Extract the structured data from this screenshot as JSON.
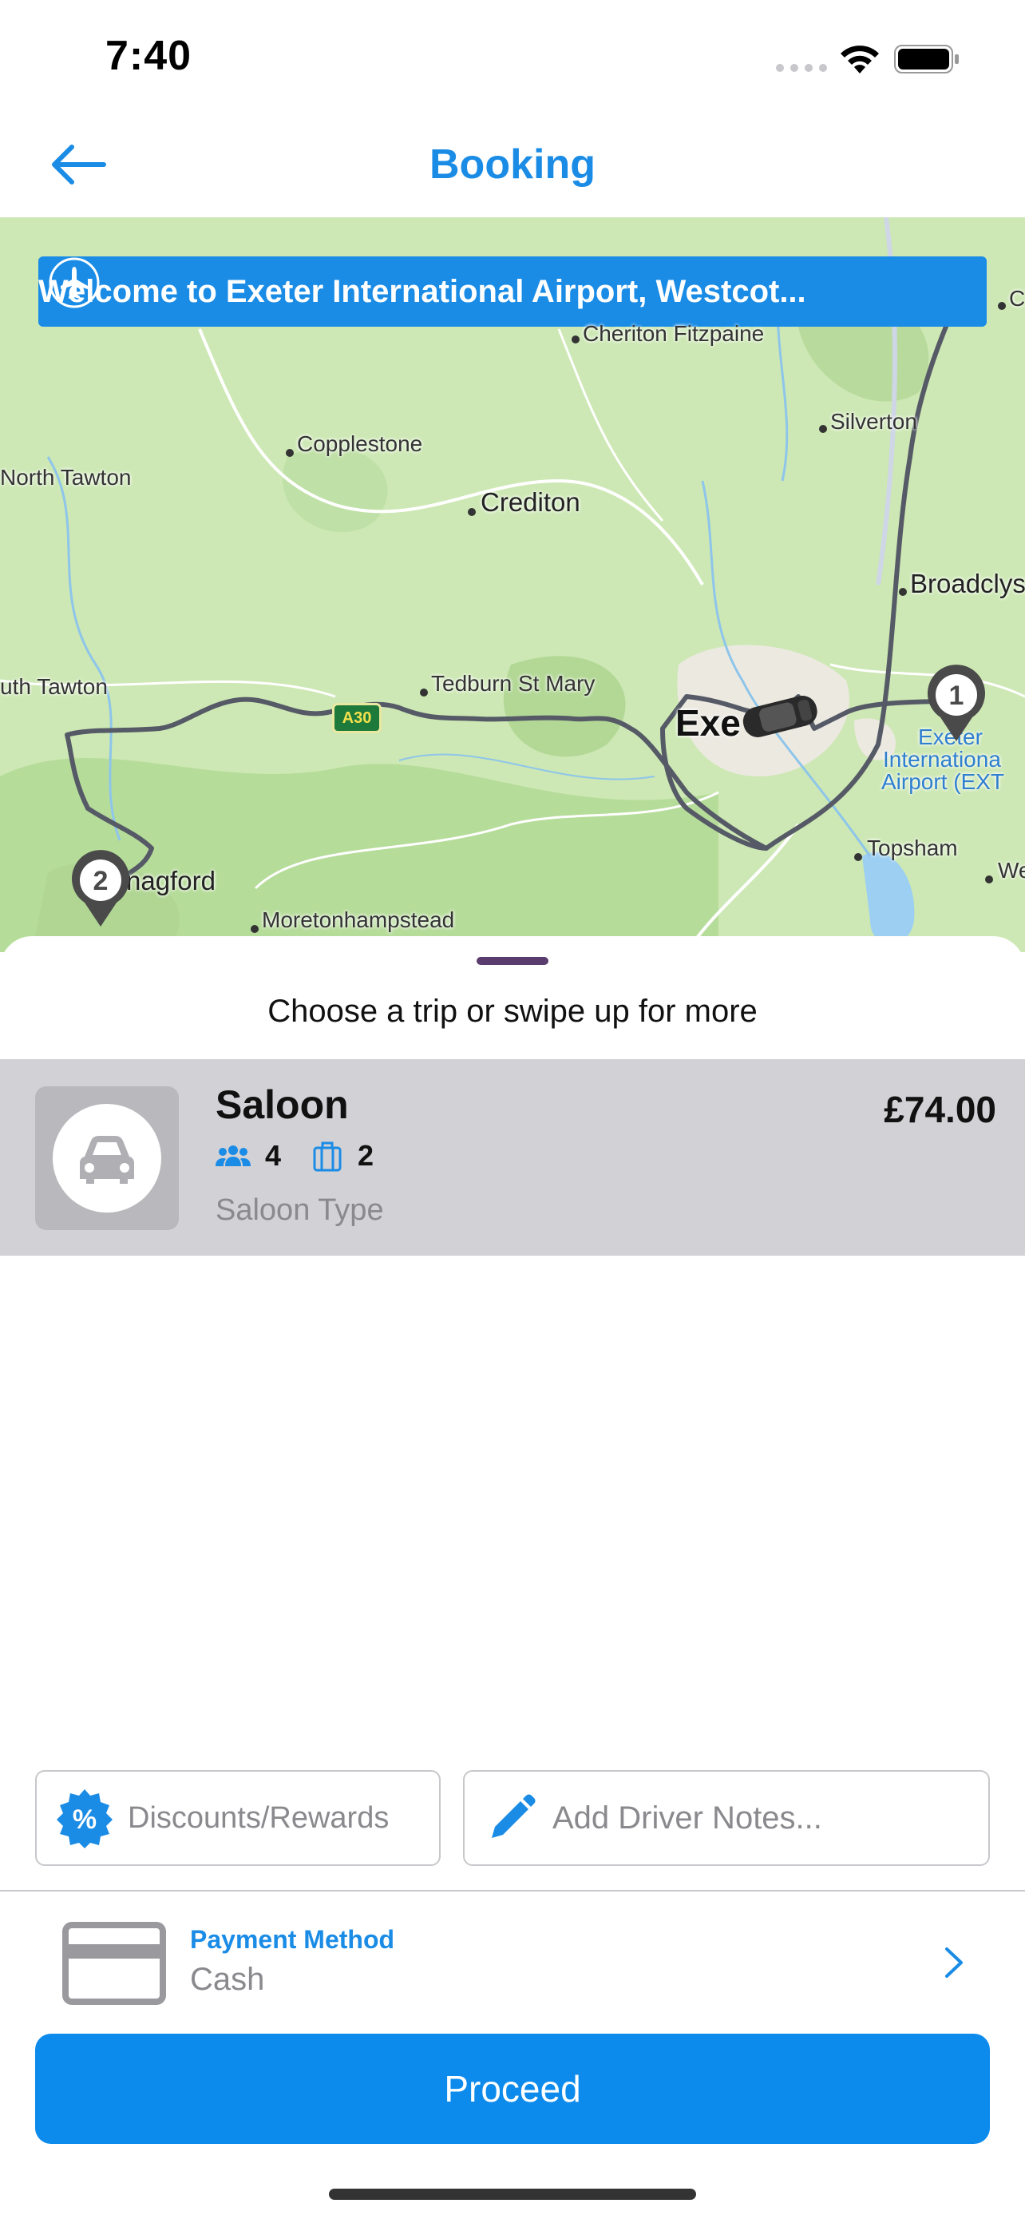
{
  "status_bar": {
    "time": "7:40"
  },
  "nav": {
    "title": "Booking",
    "back_icon": "arrow-left-icon"
  },
  "map": {
    "banner_text": "Welcome to Exeter International Airport, Westcot...",
    "banner_icon": "airplane-icon",
    "road_badge": "A30",
    "places": {
      "cheriton": "Cheriton Fitzpaine",
      "copplestone": "Copplestone",
      "silverton": "Silverton",
      "north_tawton": "North Tawton",
      "crediton": "Crediton",
      "broadclyst": "Broadclys",
      "south_tawton": "uth Tawton",
      "tedburn": "Tedburn St Mary",
      "exeter": "Exe",
      "airport_1": "Exeter",
      "airport_2": "Internationa",
      "airport_3": "Airport (EXT",
      "topsham": "Topsham",
      "chagford": "nagford",
      "moretonhampstead": "Moretonhampstead",
      "west_edge": "We",
      "corner_c": "C"
    },
    "pin_1": "1",
    "pin_2": "2"
  },
  "sheet": {
    "subtitle": "Choose a trip or swipe up for more",
    "trip": {
      "name": "Saloon",
      "passengers": "4",
      "luggage": "2",
      "description": "Saloon Type",
      "price": "£74.00"
    },
    "discount_label": "Discounts/Rewards",
    "notes_placeholder": "Add Driver Notes...",
    "payment": {
      "title": "Payment Method",
      "value": "Cash"
    },
    "proceed_label": "Proceed"
  },
  "colors": {
    "accent": "#1a8ce6",
    "proceed": "#0c8bed",
    "selected_row": "#d2d1d6",
    "map_land": "#cde8b4"
  }
}
